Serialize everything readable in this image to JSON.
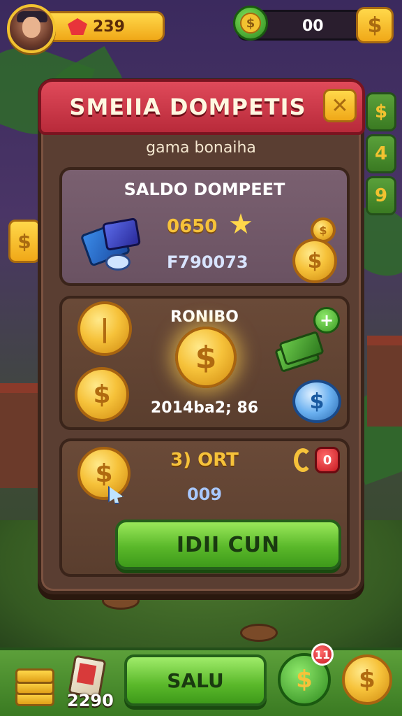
{
  "topbar": {
    "gems": "239",
    "coins": "00",
    "add_symbol": "$"
  },
  "side": {
    "gold_symbol": "$",
    "items": [
      "$",
      "4",
      "9"
    ]
  },
  "modal": {
    "title": "SMEIIA DOMPETIS",
    "close_symbol": "✕",
    "subtitle": "gama bonaiha",
    "saldo": {
      "title": "SALDO DOMPEET",
      "balance": "0650",
      "code": "F790073"
    },
    "bonus": {
      "title": "RONIBO",
      "value": "2014ba2; 86",
      "plus_symbol": "+"
    },
    "reward": {
      "amount": "3) ORT",
      "code": "009",
      "badge": "0",
      "cta_label": "IDII CUN"
    },
    "coin_symbol": "$"
  },
  "bottombar": {
    "card_count": "2290",
    "main_label": "SALU",
    "badge_count": "11",
    "coin_symbol": "$"
  },
  "colors": {
    "header_red": "#c8303e",
    "cta_green": "#5ab82a",
    "gold": "#f6c23a",
    "panel_brown": "#5a3e32"
  }
}
